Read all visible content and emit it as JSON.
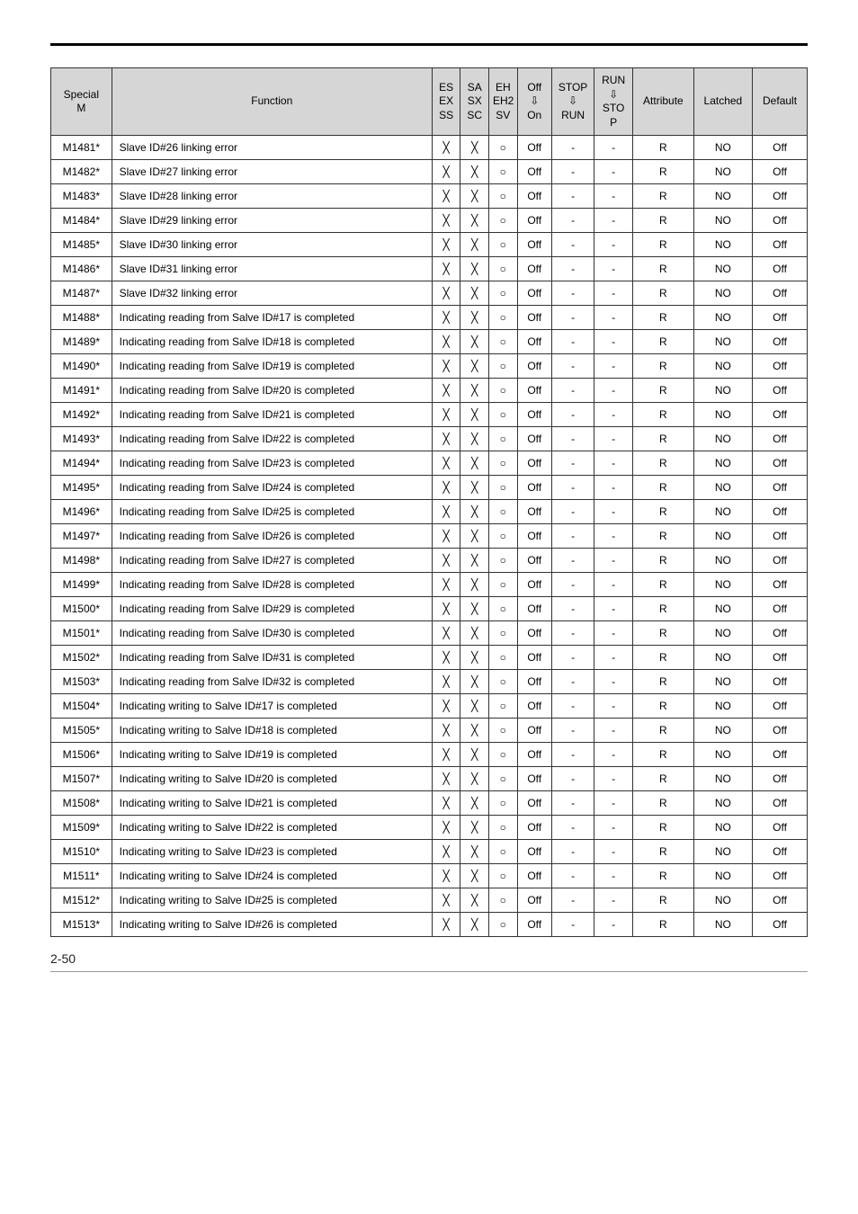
{
  "header": {
    "special_m": "Special\nM",
    "function": "Function",
    "es_ex_ss": "ES\nEX\nSS",
    "sa_sx_sc": "SA\nSX\nSC",
    "eh_eh2_sv": "EH\nEH2\nSV",
    "off_on": {
      "top": "Off",
      "mid": "⇩",
      "bot": "On"
    },
    "stop_run": {
      "top": "STOP",
      "mid": "⇩",
      "bot": "RUN"
    },
    "run_stop": {
      "top": "RUN",
      "mid": "⇩",
      "bot": "STO\nP"
    },
    "attribute": "Attribute",
    "latched": "Latched",
    "default": "Default"
  },
  "symbols": {
    "x": "╳",
    "o": "○",
    "dash": "-"
  },
  "rows": [
    {
      "m": "M1481*",
      "func": "Slave ID#26 linking error"
    },
    {
      "m": "M1482*",
      "func": "Slave ID#27 linking error"
    },
    {
      "m": "M1483*",
      "func": "Slave ID#28 linking error"
    },
    {
      "m": "M1484*",
      "func": "Slave ID#29 linking error"
    },
    {
      "m": "M1485*",
      "func": "Slave ID#30 linking error"
    },
    {
      "m": "M1486*",
      "func": "Slave ID#31 linking error"
    },
    {
      "m": "M1487*",
      "func": "Slave ID#32 linking error"
    },
    {
      "m": "M1488*",
      "func": "Indicating reading from Salve ID#17 is completed"
    },
    {
      "m": "M1489*",
      "func": "Indicating reading from Salve ID#18 is completed"
    },
    {
      "m": "M1490*",
      "func": "Indicating reading from Salve ID#19 is completed"
    },
    {
      "m": "M1491*",
      "func": "Indicating reading from Salve ID#20 is completed"
    },
    {
      "m": "M1492*",
      "func": "Indicating reading from Salve ID#21 is completed"
    },
    {
      "m": "M1493*",
      "func": "Indicating reading from Salve ID#22 is completed"
    },
    {
      "m": "M1494*",
      "func": "Indicating reading from Salve ID#23 is completed"
    },
    {
      "m": "M1495*",
      "func": "Indicating reading from Salve ID#24 is completed"
    },
    {
      "m": "M1496*",
      "func": "Indicating reading from Salve ID#25 is completed"
    },
    {
      "m": "M1497*",
      "func": "Indicating reading from Salve ID#26 is completed"
    },
    {
      "m": "M1498*",
      "func": "Indicating reading from Salve ID#27 is completed"
    },
    {
      "m": "M1499*",
      "func": "Indicating reading from Salve ID#28 is completed"
    },
    {
      "m": "M1500*",
      "func": "Indicating reading from Salve ID#29 is completed"
    },
    {
      "m": "M1501*",
      "func": "Indicating reading from Salve ID#30 is completed"
    },
    {
      "m": "M1502*",
      "func": "Indicating reading from Salve ID#31 is completed"
    },
    {
      "m": "M1503*",
      "func": "Indicating reading from Salve ID#32 is completed"
    },
    {
      "m": "M1504*",
      "func": "Indicating writing to Salve ID#17 is completed"
    },
    {
      "m": "M1505*",
      "func": "Indicating writing to Salve ID#18 is completed"
    },
    {
      "m": "M1506*",
      "func": "Indicating writing to Salve ID#19 is completed"
    },
    {
      "m": "M1507*",
      "func": "Indicating writing to Salve ID#20 is completed"
    },
    {
      "m": "M1508*",
      "func": "Indicating writing to Salve ID#21 is completed"
    },
    {
      "m": "M1509*",
      "func": "Indicating writing to Salve ID#22 is completed"
    },
    {
      "m": "M1510*",
      "func": "Indicating writing to Salve ID#23 is completed"
    },
    {
      "m": "M1511*",
      "func": "Indicating writing to Salve ID#24 is completed"
    },
    {
      "m": "M1512*",
      "func": "Indicating writing to Salve ID#25 is completed"
    },
    {
      "m": "M1513*",
      "func": "Indicating writing to Salve ID#26 is completed"
    }
  ],
  "common": {
    "es": "╳",
    "sa": "╳",
    "eh": "○",
    "off": "Off",
    "stop": "-",
    "run": "-",
    "attr": "R",
    "latched": "NO",
    "default": "Off"
  },
  "footer": {
    "page": "2-50"
  }
}
